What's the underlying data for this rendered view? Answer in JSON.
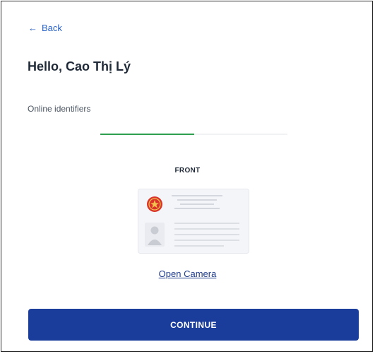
{
  "nav": {
    "back_icon": "arrow-left-icon",
    "back_label": "Back"
  },
  "greeting": "Hello, Cao Thị Lý",
  "section_label": "Online identifiers",
  "progress": {
    "step": 1,
    "total_steps": 2,
    "fraction_complete": 0.5,
    "color": "#2e9e4f"
  },
  "id_capture": {
    "side_label": "FRONT",
    "illustration_icon": "id-card-front-icon",
    "open_camera_label": "Open Camera"
  },
  "actions": {
    "continue_label": "CONTINUE"
  },
  "colors": {
    "primary": "#1a3d9c",
    "link": "#2a62c7",
    "emblem": "#d9332a"
  }
}
